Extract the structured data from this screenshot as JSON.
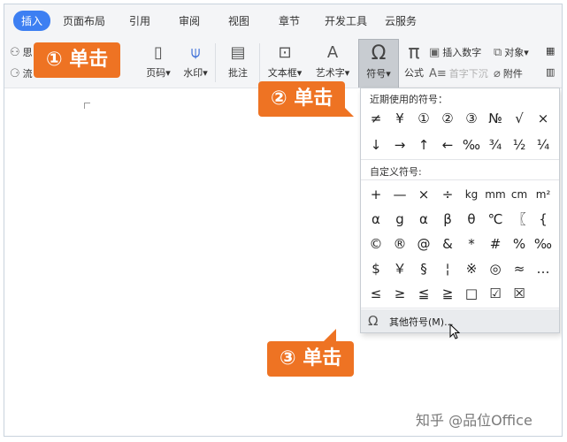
{
  "tabs": [
    "插入",
    "页面布局",
    "引用",
    "审阅",
    "视图",
    "章节",
    "开发工具",
    "云服务"
  ],
  "ribbon": {
    "left_partial": [
      "思",
      "流"
    ],
    "page_num": "页码",
    "watermark_btn": "水印",
    "annotation": "批注",
    "textbox": "文本框",
    "wordart": "艺术字",
    "symbol": "符号",
    "formula": "公式",
    "insert_number": "插入数字",
    "object": "对象",
    "drop_cap": "首字下沉",
    "attachment": "附件",
    "dropdown_glyph": "▾"
  },
  "symbol_panel": {
    "recent_title": "近期使用的符号：",
    "recent": [
      "≠",
      "¥",
      "①",
      "②",
      "③",
      "№",
      "√",
      "×",
      "↓",
      "→",
      "↑",
      "←",
      "‰",
      "¾",
      "½",
      "¼"
    ],
    "custom_title": "自定义符号:",
    "custom": [
      "+",
      "—",
      "×",
      "÷",
      "kg",
      "mm",
      "cm",
      "m²",
      "α",
      "ց",
      "α",
      "β",
      "θ",
      "℃",
      "〖",
      "{",
      "©",
      "®",
      "@",
      "&",
      "*",
      "#",
      "%",
      "‰",
      "$",
      "￥",
      "§",
      "¦",
      "※",
      "◎",
      "≈",
      "…",
      "≤",
      "≥",
      "≦",
      "≧",
      "□",
      "☑",
      "☒"
    ],
    "other_label": "其他符号(M)..."
  },
  "callouts": {
    "step1": "① 单击",
    "step2": "② 单击",
    "step3": "③ 单击"
  },
  "watermark": "知乎 @品位Office",
  "colors": {
    "accent_tab": "#3d7ff2",
    "callout": "#ee7323"
  }
}
